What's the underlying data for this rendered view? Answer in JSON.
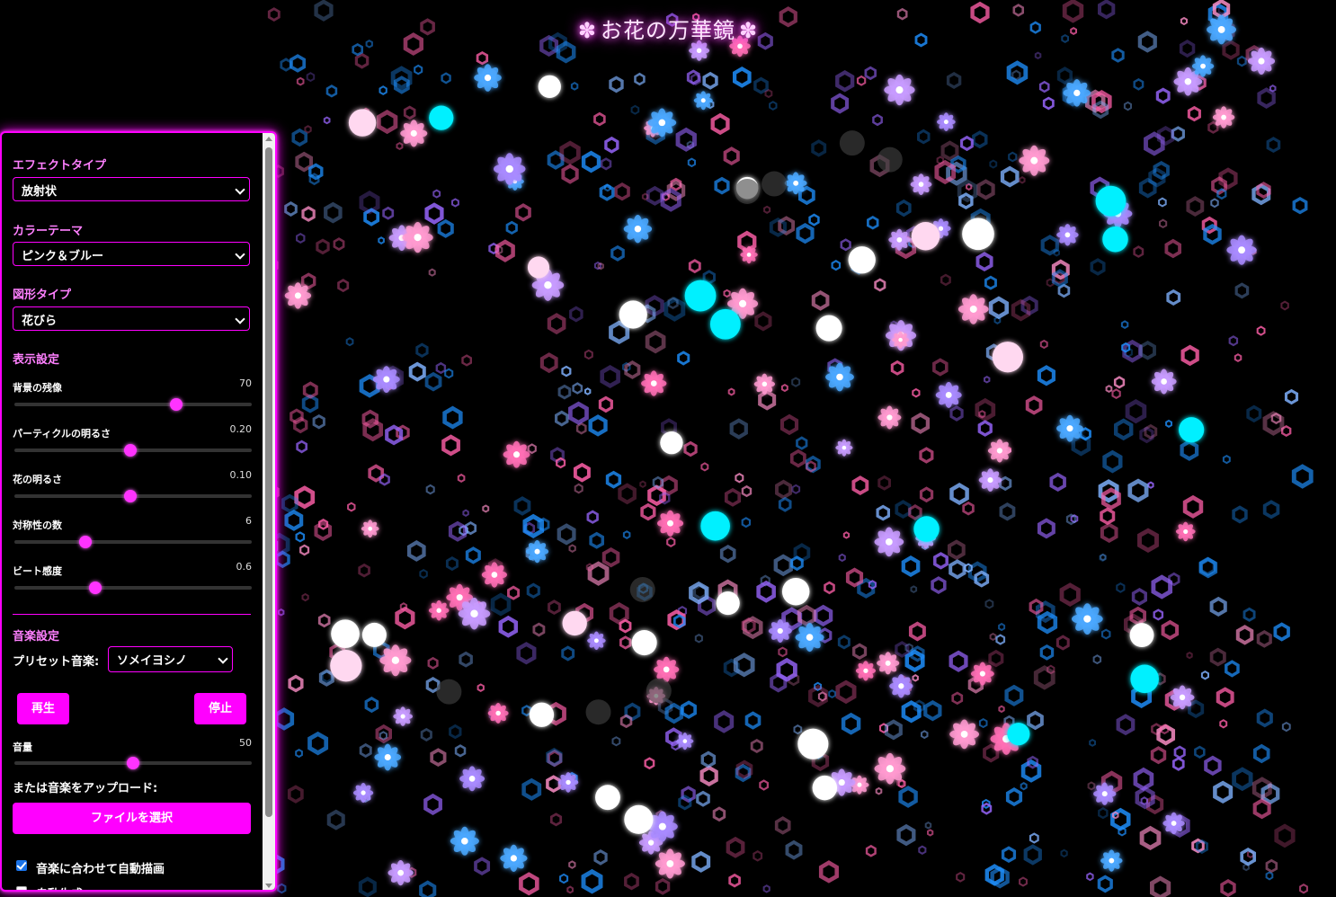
{
  "title": "お花の万華鏡",
  "title_icon": "flower-icon",
  "panel": {
    "effect_type": {
      "label": "エフェクトタイプ",
      "value": "放射状"
    },
    "color_theme": {
      "label": "カラーテーマ",
      "value": "ピンク＆ブルー"
    },
    "shape_type": {
      "label": "図形タイプ",
      "value": "花びら"
    },
    "display": {
      "label": "表示設定",
      "sliders": [
        {
          "label": "背景の残像",
          "value": "70",
          "fraction": 0.68
        },
        {
          "label": "パーティクルの明るさ",
          "value": "0.20",
          "fraction": 0.49
        },
        {
          "label": "花の明るさ",
          "value": "0.10",
          "fraction": 0.49
        },
        {
          "label": "対称性の数",
          "value": "6",
          "fraction": 0.3
        },
        {
          "label": "ビート感度",
          "value": "0.6",
          "fraction": 0.34
        }
      ]
    },
    "music": {
      "label": "音楽設定",
      "preset_label": "プリセット音楽:",
      "preset_value": "ソメイヨシノ",
      "play": "再生",
      "stop": "停止",
      "volume_label": "音量",
      "volume_value": "50",
      "volume_fraction": 0.5,
      "upload_label": "または音楽をアップロード:",
      "file_button": "ファイルを選択"
    },
    "checkboxes": [
      {
        "label": "音楽に合わせて自動描画",
        "checked": true
      },
      {
        "label": "自動生成",
        "checked": false
      }
    ]
  },
  "colors": {
    "accent": "#ff00ff",
    "pink": "#ff5fa8",
    "blue": "#1e90ff",
    "cyan": "#00f0ff",
    "purple": "#9966ff"
  }
}
